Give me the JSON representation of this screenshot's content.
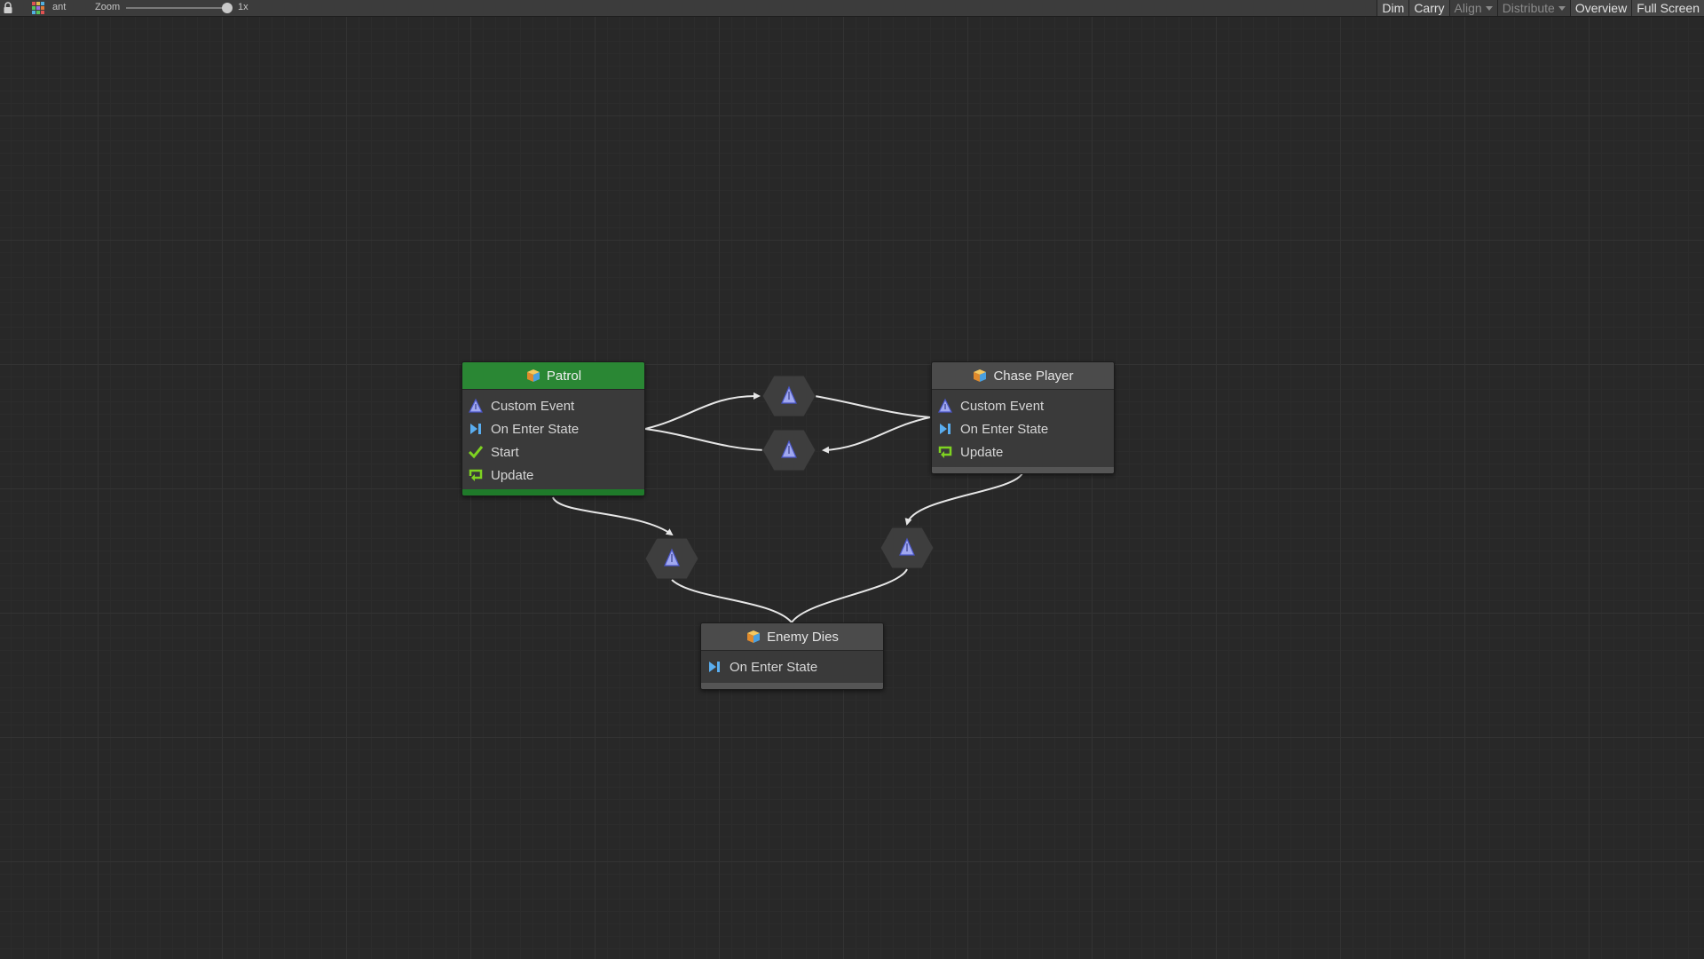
{
  "toolbar": {
    "graph_name": "ant",
    "zoom_label": "Zoom",
    "zoom_value": "1x",
    "zoom_level": 1,
    "buttons": {
      "dim": "Dim",
      "carry": "Carry",
      "align": "Align",
      "distribute": "Distribute",
      "overview": "Overview",
      "full_screen": "Full Screen"
    }
  },
  "states": {
    "patrol": {
      "title": "Patrol",
      "is_start": true,
      "events": [
        "Custom Event",
        "On Enter State",
        "Start",
        "Update"
      ]
    },
    "chase": {
      "title": "Chase Player",
      "is_start": false,
      "events": [
        "Custom Event",
        "On Enter State",
        "Update"
      ]
    },
    "enemy": {
      "title": "Enemy Dies",
      "is_start": false,
      "events": [
        "On Enter State"
      ]
    }
  },
  "transitions": [
    {
      "from": "Patrol",
      "to": "Chase Player"
    },
    {
      "from": "Chase Player",
      "to": "Patrol"
    },
    {
      "from": "Patrol",
      "to": "Enemy Dies"
    },
    {
      "from": "Chase Player",
      "to": "Enemy Dies"
    }
  ],
  "icons": {
    "state": "state-box-icon",
    "custom_event": "custom-event-icon",
    "on_enter_state": "on-enter-state-icon",
    "start": "start-check-icon",
    "update": "update-loop-icon",
    "transition": "transition-icon"
  },
  "colors": {
    "canvas": "#282828",
    "start_state_header": "#2a8734",
    "state_header": "#4b4b4b",
    "wire": "#e6e6e6"
  }
}
